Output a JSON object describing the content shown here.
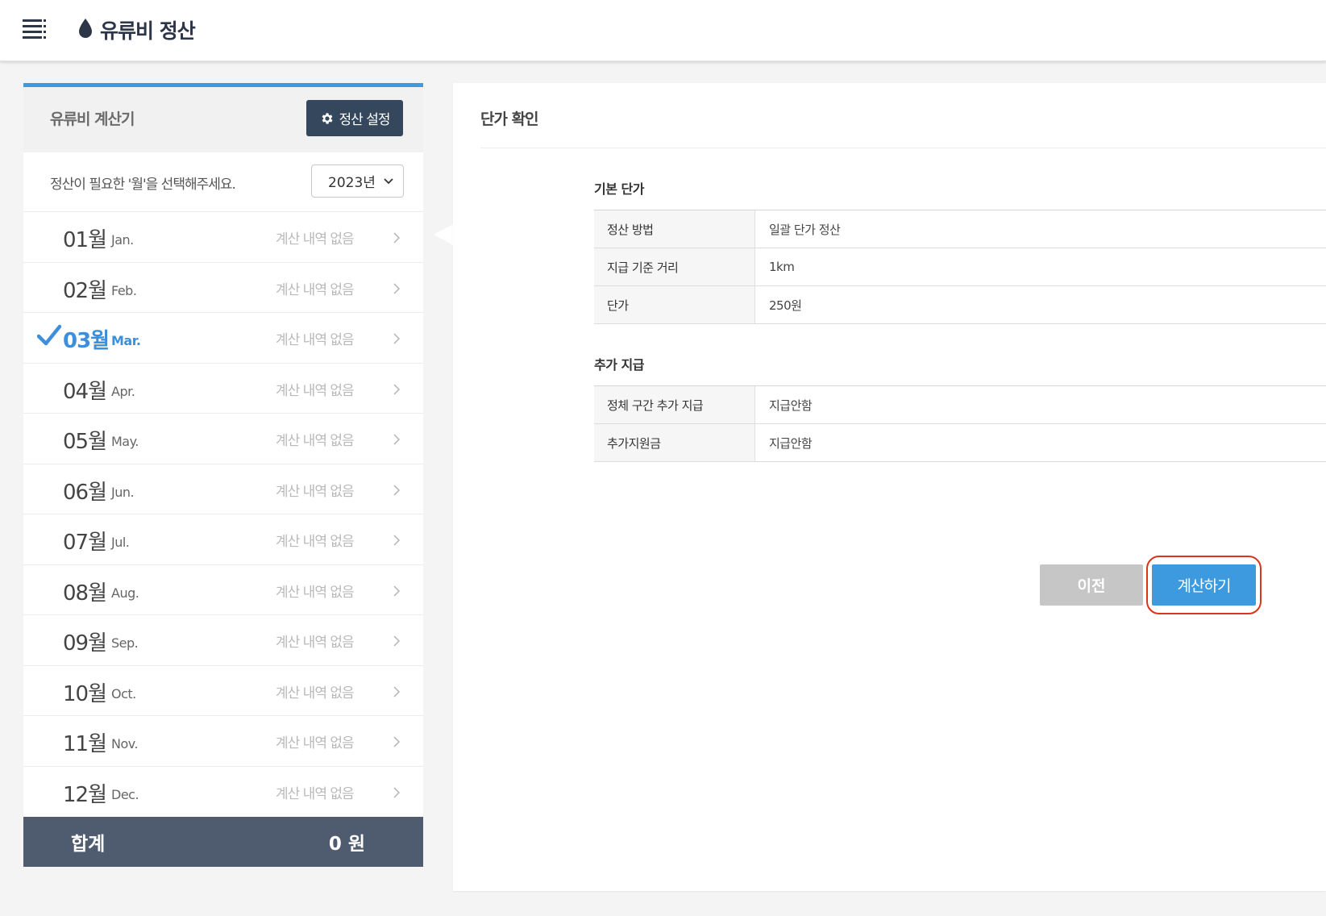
{
  "header": {
    "title": "유류비 정산",
    "menu_icon": "menu-icon",
    "brand_icon": "drop-icon"
  },
  "colors": {
    "accent": "#3e9ade",
    "dark": "#35475d",
    "total_bg": "#4f5b6f",
    "highlight": "#d9341c"
  },
  "calculator": {
    "title": "유류비 계산기",
    "settings_label": "정산 설정",
    "prompt": "정산이 필요한 '월'을 선택해주세요.",
    "year": "2023년",
    "months": [
      {
        "num": "01월",
        "en": "Jan.",
        "status": "계산 내역 없음",
        "selected": false
      },
      {
        "num": "02월",
        "en": "Feb.",
        "status": "계산 내역 없음",
        "selected": false
      },
      {
        "num": "03월",
        "en": "Mar.",
        "status": "계산 내역 없음",
        "selected": true
      },
      {
        "num": "04월",
        "en": "Apr.",
        "status": "계산 내역 없음",
        "selected": false
      },
      {
        "num": "05월",
        "en": "May.",
        "status": "계산 내역 없음",
        "selected": false
      },
      {
        "num": "06월",
        "en": "Jun.",
        "status": "계산 내역 없음",
        "selected": false
      },
      {
        "num": "07월",
        "en": "Jul.",
        "status": "계산 내역 없음",
        "selected": false
      },
      {
        "num": "08월",
        "en": "Aug.",
        "status": "계산 내역 없음",
        "selected": false
      },
      {
        "num": "09월",
        "en": "Sep.",
        "status": "계산 내역 없음",
        "selected": false
      },
      {
        "num": "10월",
        "en": "Oct.",
        "status": "계산 내역 없음",
        "selected": false
      },
      {
        "num": "11월",
        "en": "Nov.",
        "status": "계산 내역 없음",
        "selected": false
      },
      {
        "num": "12월",
        "en": "Dec.",
        "status": "계산 내역 없음",
        "selected": false
      }
    ],
    "total_label": "합계",
    "total_value": "0 원"
  },
  "detail": {
    "title": "단가 확인",
    "basic": {
      "title": "기본 단가",
      "rows": [
        {
          "key": "정산 방법",
          "value": "일괄 단가 정산"
        },
        {
          "key": "지급 기준 거리",
          "value": "1km"
        },
        {
          "key": "단가",
          "value": "250원"
        }
      ]
    },
    "extra": {
      "title": "추가 지급",
      "rows": [
        {
          "key": "정체 구간 추가 지급",
          "value": "지급안함"
        },
        {
          "key": "추가지원금",
          "value": "지급안함"
        }
      ]
    },
    "prev_label": "이전",
    "calc_label": "계산하기"
  }
}
